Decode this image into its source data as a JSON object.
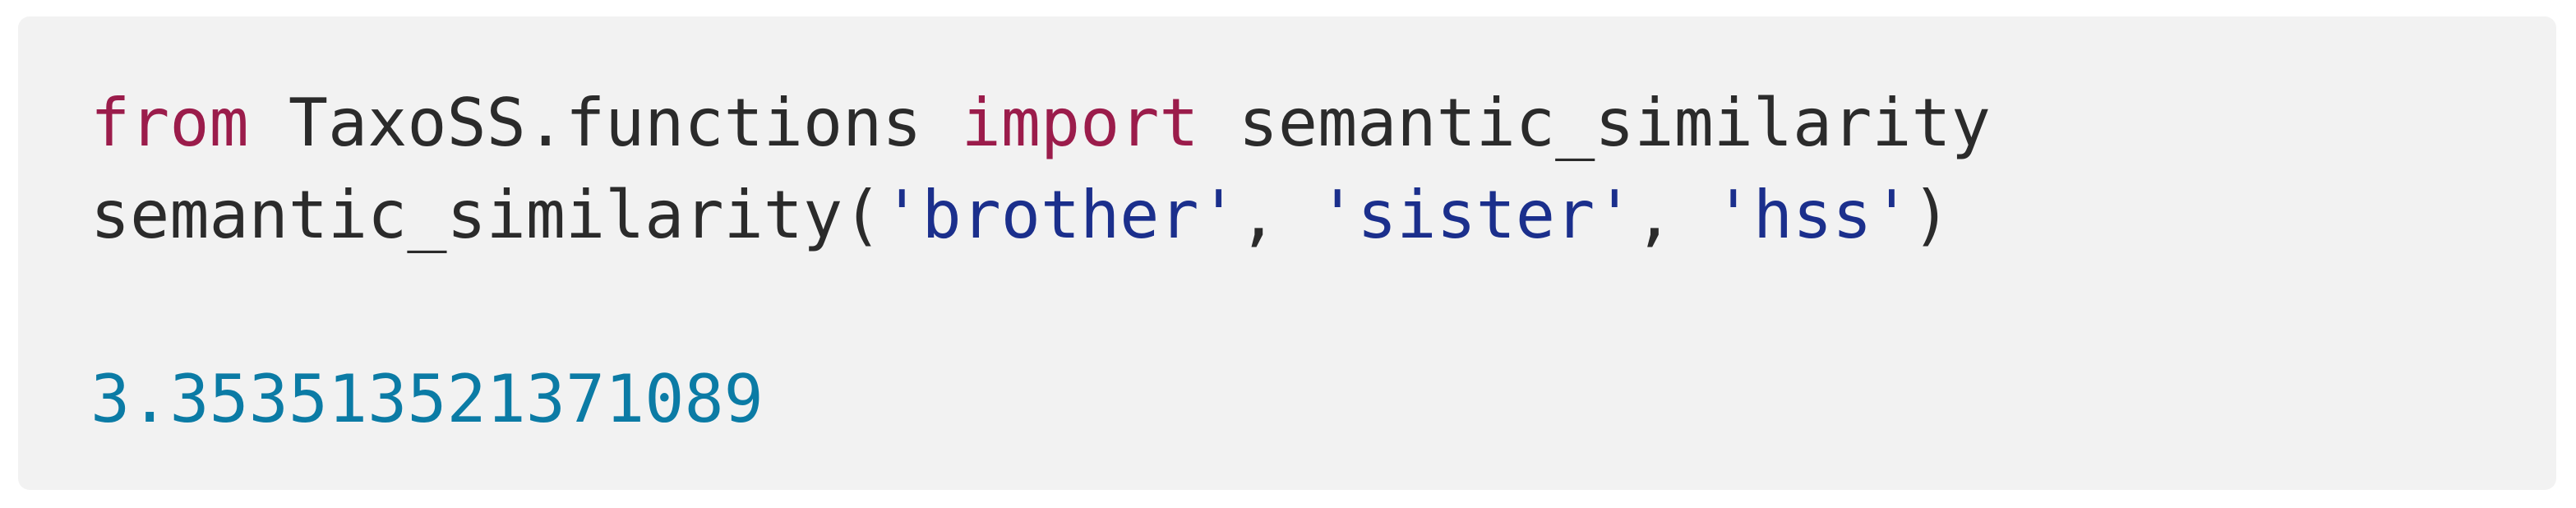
{
  "code": {
    "line1": {
      "kw_from": "from",
      "module": " TaxoSS.functions ",
      "kw_import": "import",
      "name": " semantic_similarity"
    },
    "line2": {
      "call": "semantic_similarity(",
      "arg1": "'brother'",
      "sep1": ", ",
      "arg2": "'sister'",
      "sep2": ", ",
      "arg3": "'hss'",
      "close": ")"
    },
    "output": "3.353513521371089"
  },
  "colors": {
    "background": "#f2f2f2",
    "keyword": "#9b1c4b",
    "string": "#1b2f8c",
    "output": "#0b7ba5",
    "text": "#2b2b2b"
  }
}
